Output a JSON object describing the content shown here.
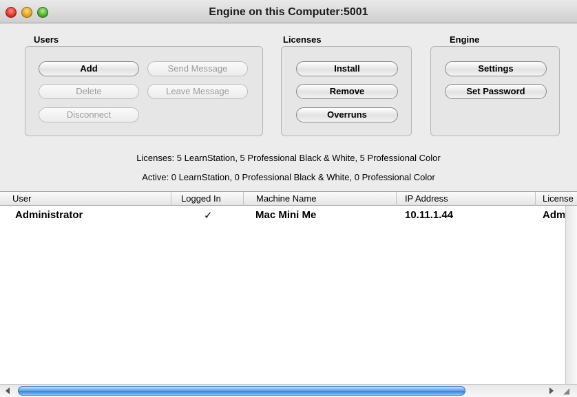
{
  "window": {
    "title": "Engine on this Computer:5001"
  },
  "groups": {
    "users": {
      "label": "Users",
      "buttons": {
        "add": "Add",
        "send_message": "Send Message",
        "delete": "Delete",
        "leave_message": "Leave Message",
        "disconnect": "Disconnect"
      }
    },
    "licenses": {
      "label": "Licenses",
      "buttons": {
        "install": "Install",
        "remove": "Remove",
        "overruns": "Overruns"
      }
    },
    "engine": {
      "label": "Engine",
      "buttons": {
        "settings": "Settings",
        "set_password": "Set Password"
      }
    }
  },
  "info": {
    "licenses_line": "Licenses: 5 LearnStation, 5 Professional Black & White, 5 Professional Color",
    "active_line": "Active: 0 LearnStation, 0 Professional Black & White, 0 Professional Color"
  },
  "table": {
    "columns": [
      "User",
      "Logged In",
      "Machine Name",
      "IP Address",
      "License"
    ],
    "rows": [
      [
        "Administrator",
        "✓",
        "Mac Mini Me",
        "10.11.1.44",
        "Adm"
      ]
    ]
  },
  "icons": {
    "close": "close-icon",
    "minimize": "minimize-icon",
    "zoom": "zoom-icon",
    "scroll_left": "scroll-left-icon",
    "scroll_right": "scroll-right-icon",
    "resize_grip": "resize-grip-icon"
  },
  "colors": {
    "close_button": "#d6261b",
    "minimize_button": "#d99a12",
    "zoom_button": "#3f9e22",
    "scroll_thumb": "#5aa1ea"
  }
}
